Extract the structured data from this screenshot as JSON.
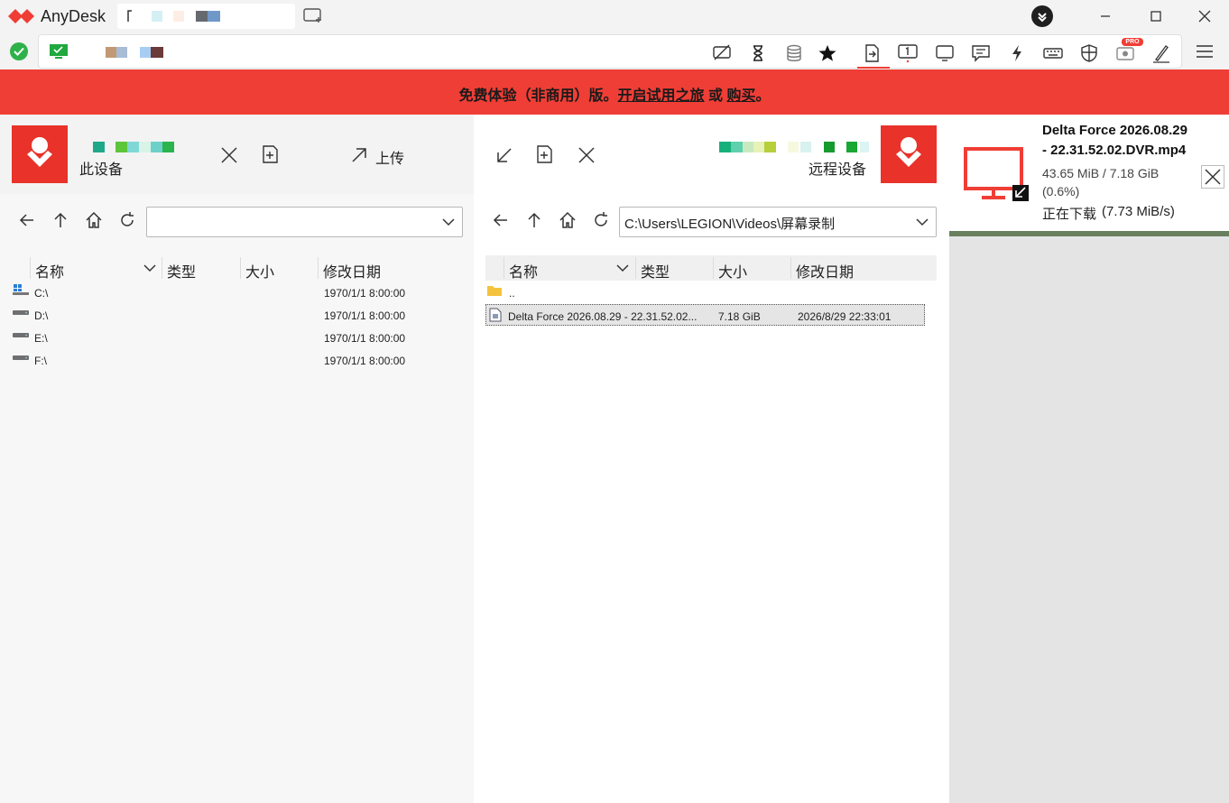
{
  "app": {
    "title": "AnyDesk"
  },
  "banner": {
    "prefix": "免费体验（非商用）版。",
    "trial_link": "开启试用之旅",
    "or": " 或 ",
    "buy_link": "购买",
    "suffix": "。"
  },
  "local": {
    "device_label": "此设备",
    "upload_label": "上传",
    "path": "",
    "columns": {
      "name": "名称",
      "type": "类型",
      "size": "大小",
      "modified": "修改日期"
    },
    "drives": [
      {
        "name": "C:\\",
        "modified": "1970/1/1 8:00:00",
        "icon": "windows-drive-icon"
      },
      {
        "name": "D:\\",
        "modified": "1970/1/1 8:00:00",
        "icon": "drive-icon"
      },
      {
        "name": "E:\\",
        "modified": "1970/1/1 8:00:00",
        "icon": "drive-icon"
      },
      {
        "name": "F:\\",
        "modified": "1970/1/1 8:00:00",
        "icon": "drive-icon"
      }
    ]
  },
  "remote": {
    "device_label": "远程设备",
    "path": "C:\\Users\\LEGION\\Videos\\屏幕录制",
    "columns": {
      "name": "名称",
      "type": "类型",
      "size": "大小",
      "modified": "修改日期"
    },
    "parent_entry": "..",
    "files": [
      {
        "name": "Delta Force 2026.08.29 - 22.31.52.02...",
        "size": "7.18 GiB",
        "modified": "2026/8/29 22:33:01"
      }
    ]
  },
  "transfer": {
    "filename_line1": "Delta Force 2026.08.29",
    "filename_line2": "- 22.31.52.02.DVR.mp4",
    "progress_text": "43.65 MiB / 7.18 GiB",
    "percent_text": "(0.6%)",
    "status": "正在下载",
    "speed": "(7.73 MiB/s)",
    "progress_fraction": 0.006
  },
  "colors": {
    "brand": "#ef3e36",
    "logo": "#e8322a",
    "online": "#2fb14a"
  }
}
